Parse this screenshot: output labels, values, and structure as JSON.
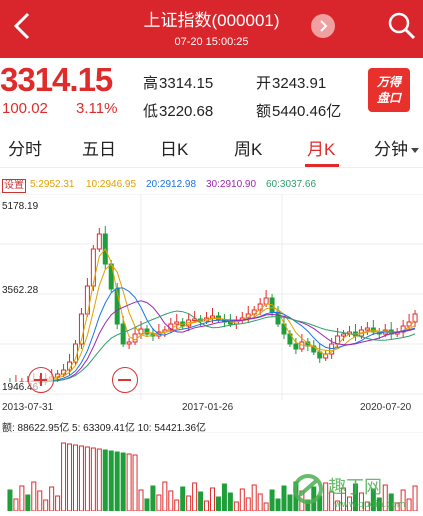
{
  "header": {
    "title": "上证指数(000001)",
    "datetime": "07-20 15:00:25",
    "back_icon": "back-chevron-icon",
    "next_icon": "next-chevron-icon",
    "search_icon": "search-icon"
  },
  "quote": {
    "price": "3314.15",
    "change": "100.02",
    "change_pct": "3.11%",
    "high_label": "高",
    "high": "3314.15",
    "open_label": "开",
    "open": "3243.91",
    "low_label": "低",
    "low": "3220.68",
    "amount_label": "额",
    "amount": "5440.46亿",
    "badge_line1": "万得",
    "badge_line2": "盘口"
  },
  "tabs": [
    {
      "label": "分时"
    },
    {
      "label": "五日"
    },
    {
      "label": "日K"
    },
    {
      "label": "周K"
    },
    {
      "label": "月K",
      "active": true
    },
    {
      "label": "分钟"
    }
  ],
  "ma_bar": {
    "settings": "设置",
    "ma5": "5:2952.31",
    "ma10": "10:2946.95",
    "ma20": "20:2912.98",
    "ma30": "30:2910.90",
    "ma60": "60:3037.66",
    "colors": {
      "ma5": "#e6a100",
      "ma10": "#e0a000",
      "ma20": "#1a73e8",
      "ma30": "#9c27b0",
      "ma60": "#2e9e6e"
    }
  },
  "chart": {
    "y_high": "5178.19",
    "y_mid": "3562.28",
    "y_low": "1946.46",
    "dates": [
      "2013-07-31",
      "2017-01-26",
      "2020-07-20"
    ]
  },
  "volume_bar": {
    "text": "额: 88622.95亿 5: 63309.41亿 10: 54421.36亿"
  },
  "chart_data": {
    "type": "candlestick",
    "y_labels": [
      "5178.19",
      "3562.28",
      "1946.46"
    ],
    "x_labels": [
      "2013-07-31",
      "2017-01-26",
      "2020-07-20"
    ],
    "ylim": [
      1946.46,
      5178.19
    ],
    "series": [
      {
        "name": "5",
        "last": "2952.31"
      },
      {
        "name": "10",
        "last": "2946.95"
      },
      {
        "name": "20",
        "last": "2912.98"
      },
      {
        "name": "30",
        "last": "2910.90"
      },
      {
        "name": "60",
        "last": "3037.66"
      }
    ]
  },
  "colors": {
    "accent": "#d9262c",
    "up": "#e02b2b",
    "down": "#1f9e3a"
  }
}
